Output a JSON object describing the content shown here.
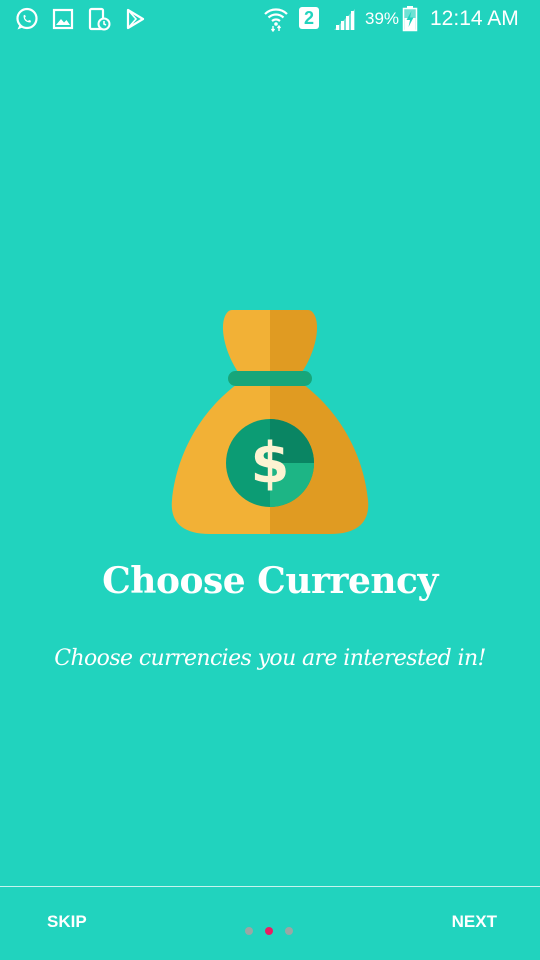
{
  "status_bar": {
    "left_icons": [
      "whatsapp-icon",
      "gallery-icon",
      "device-clock-icon",
      "play-store-icon"
    ],
    "right_icons": [
      "wifi-icon",
      "sim-2-icon",
      "signal-icon",
      "battery-charging-icon"
    ],
    "sim_label": "2",
    "battery_percent": "39%",
    "time": "12:14 AM"
  },
  "onboarding": {
    "illustration": "money-bag-dollar-icon",
    "title": "Choose Currency",
    "subtitle": "Choose currencies you are interested in!",
    "current_page": 2,
    "total_pages": 3
  },
  "bottom_bar": {
    "skip_label": "SKIP",
    "next_label": "NEXT"
  },
  "colors": {
    "background": "#21D3BE",
    "bag_light": "#F2B136",
    "bag_dark": "#E09B22",
    "coin_green": "#0C9C74",
    "coin_dark": "#0A8563",
    "coin_light": "#1DB585",
    "dot_active": "#E91E63",
    "dot_inactive": "#9AA7A5"
  }
}
